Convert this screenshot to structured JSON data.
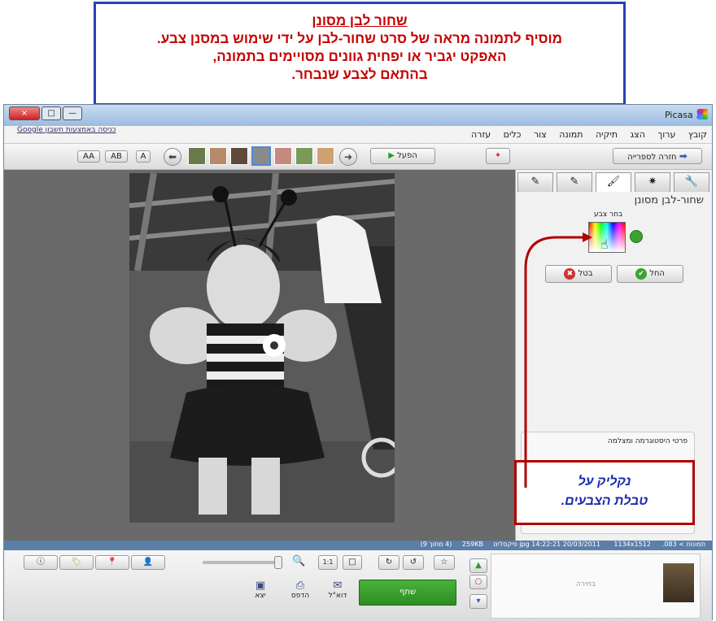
{
  "annotation": {
    "title": "שחור לבן מסונן",
    "line1": "מוסיף לתמונה מראה של סרט שחור-לבן על ידי שימוש במסנן צבע.",
    "line2": "האפקט יגביר או יפחית גוונים מסויימים בתמונה,",
    "line3": "בהתאם לצבע שנבחר."
  },
  "window": {
    "title": "Picasa 3",
    "controls": [
      "×",
      "□",
      "—"
    ]
  },
  "menu": {
    "items": [
      "קובץ",
      "ערוך",
      "הצג",
      "תיקיה",
      "תמונה",
      "צור",
      "כלים",
      "עזרה"
    ],
    "google_login": "כניסה באמצעות חשבון Google"
  },
  "toolbar": {
    "back_library": "חזרה לספרייה",
    "play": "הפעל",
    "compare_labels": [
      "A",
      "AB",
      "AA"
    ]
  },
  "panel": {
    "title": "שחור-לבן מסונן",
    "pick_color_label": "בחר צבע",
    "apply": "החל",
    "cancel": "בטל",
    "histogram": "פרטי היסטוגרמה ומצלמה"
  },
  "status": {
    "path": "תמונות > 083.jpg",
    "datetime": "14:22:21 20/03/2011",
    "size": "1134x1512 פיקסלים",
    "filesize": "259KB",
    "index": "(4 מתוך 9)"
  },
  "bottom": {
    "selection": "בחירה",
    "share": "שתף",
    "email": "דוא\"ל",
    "print": "הדפס",
    "export": "יצא"
  },
  "callout": {
    "line1": "נקליק על",
    "line2": "טבלת הצבעים."
  },
  "colors": {
    "accent_green": "#3aa22e",
    "annotation_red": "#c40000",
    "callout_blue": "#1a2db0",
    "status_blue": "#5c7fa8"
  }
}
